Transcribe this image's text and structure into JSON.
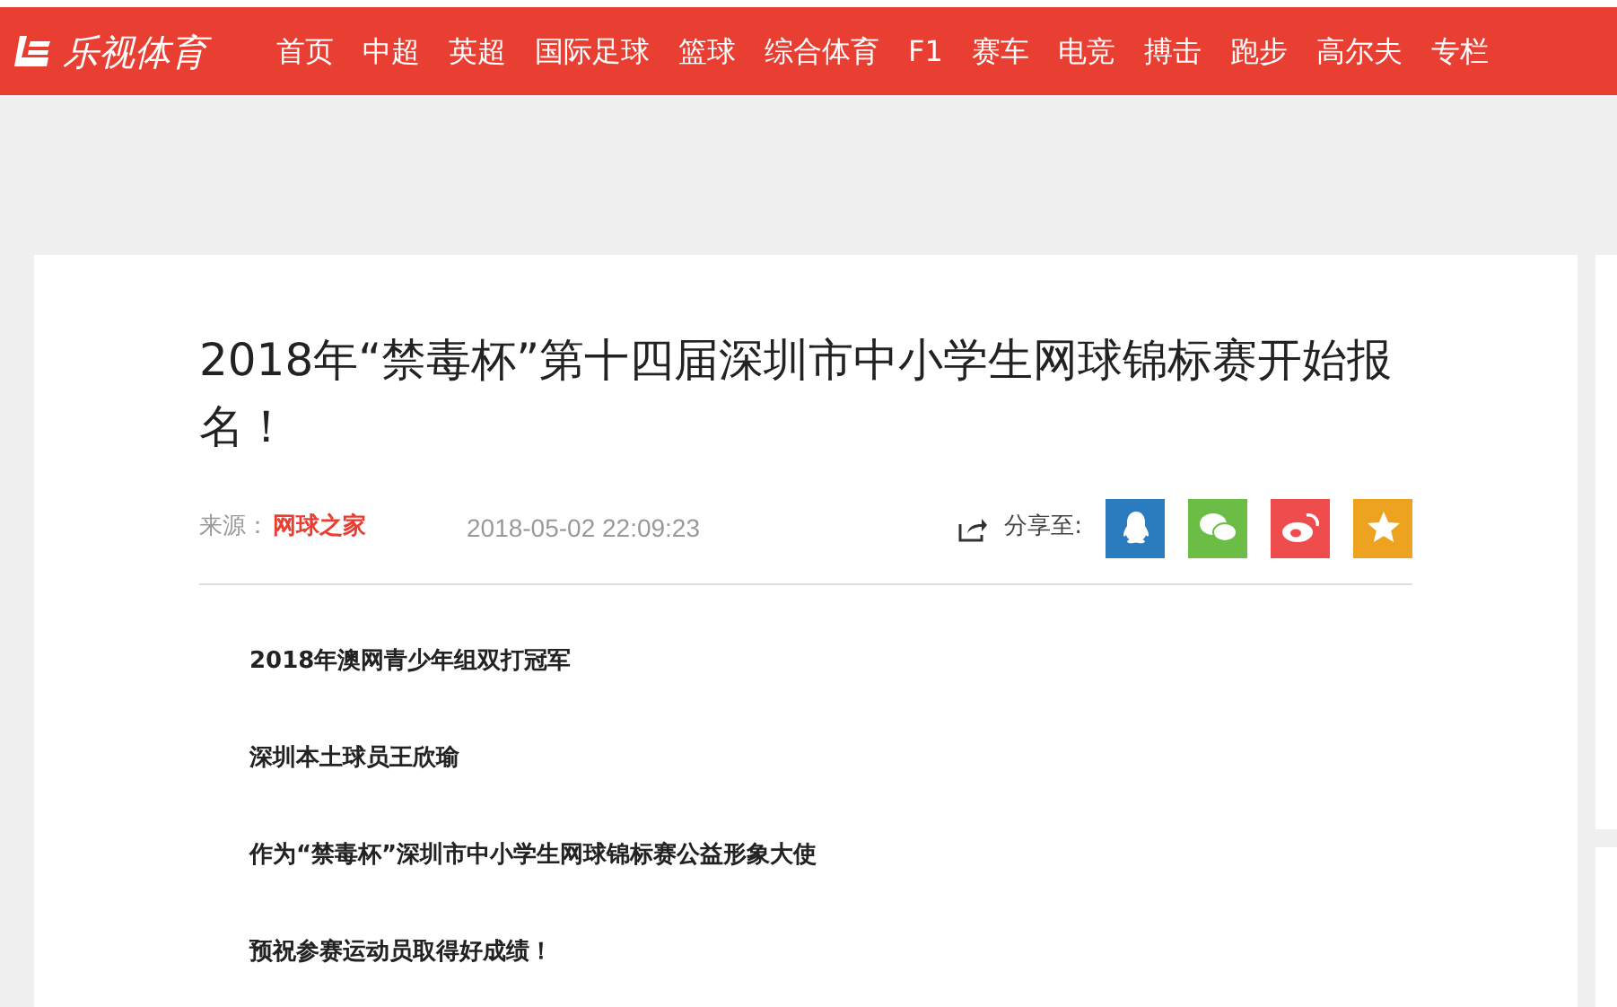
{
  "header": {
    "logo": "乐视体育",
    "nav": [
      "首页",
      "中超",
      "英超",
      "国际足球",
      "篮球",
      "综合体育",
      "F1",
      "赛车",
      "电竞",
      "搏击",
      "跑步",
      "高尔夫",
      "专栏"
    ]
  },
  "article": {
    "title": "2018年“禁毒杯”第十四届深圳市中小学生网球锦标赛开始报名！",
    "source_label": "来源：",
    "source": "网球之家",
    "time": "2018-05-02 22:09:23",
    "share_label": "分享至:",
    "share": [
      {
        "kind": "qq",
        "color": "#2b7bbf"
      },
      {
        "kind": "wechat",
        "color": "#6cbd45"
      },
      {
        "kind": "weibo",
        "color": "#ef4d4d"
      },
      {
        "kind": "qzone",
        "color": "#eea320"
      }
    ],
    "paragraphs": [
      "2018年澳网青少年组双打冠军",
      "深圳本土球员王欣瑜",
      "作为“禁毒杯”深圳市中小学生网球锦标赛公益形象大使",
      "预祝参赛运动员取得好成绩！"
    ]
  }
}
